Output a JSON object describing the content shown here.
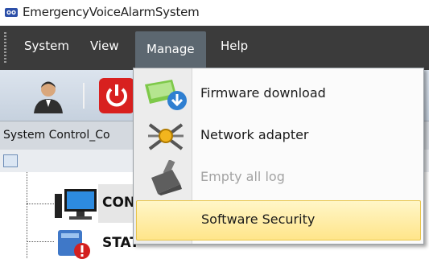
{
  "window": {
    "title": "EmergencyVoiceAlarmSystem"
  },
  "menubar": {
    "items": [
      {
        "label": "System"
      },
      {
        "label": "View"
      },
      {
        "label": "Manage"
      },
      {
        "label": "Help"
      }
    ]
  },
  "panel": {
    "header": "System Control_Co"
  },
  "tree": {
    "nodes": [
      {
        "label": "CON"
      },
      {
        "label": "STAT"
      }
    ]
  },
  "manage_menu": {
    "items": [
      {
        "label": "Firmware download",
        "icon": "firmware-download-icon",
        "enabled": true
      },
      {
        "label": "Network adapter",
        "icon": "network-adapter-icon",
        "enabled": true
      },
      {
        "label": "Empty all log",
        "icon": "broom-icon",
        "enabled": false
      },
      {
        "label": "Software Security",
        "icon": "",
        "enabled": true,
        "highlighted": true
      }
    ]
  },
  "colors": {
    "menubar_bg": "#3b3b3b",
    "highlight": "#ffe58a",
    "power_red": "#d8201f"
  }
}
